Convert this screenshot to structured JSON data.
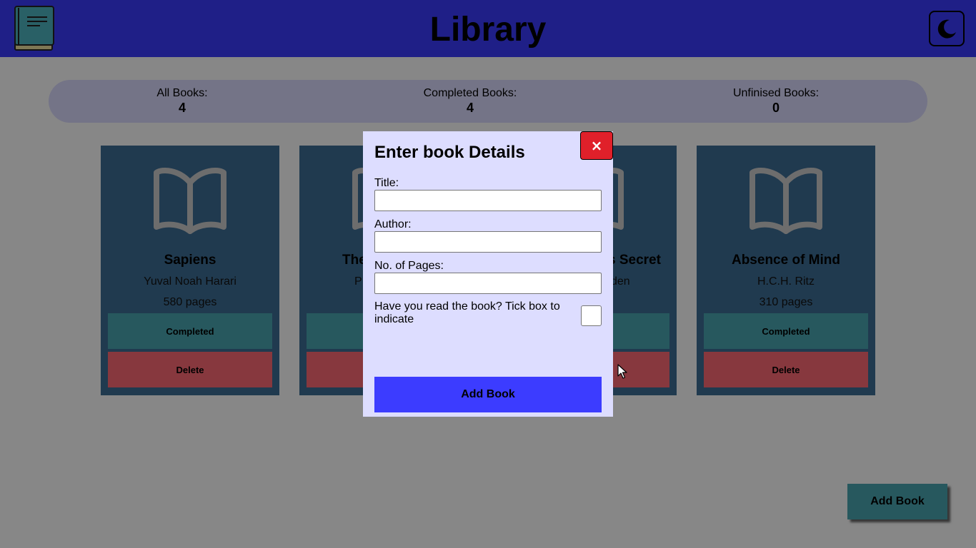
{
  "header": {
    "title": "Library",
    "logo_icon": "book-logo-icon",
    "theme_icon": "moon-icon"
  },
  "stats": [
    {
      "label": "All Books:",
      "value": "4"
    },
    {
      "label": "Completed Books:",
      "value": "4"
    },
    {
      "label": "Unfinised Books:",
      "value": "0"
    }
  ],
  "books": [
    {
      "title": "Sapiens",
      "author": "Yuval Noah Harari",
      "pages": "580 pages",
      "status_label": "Completed",
      "delete_label": "Delete"
    },
    {
      "title": "The",
      "author": "P",
      "pages": "",
      "status_label": "",
      "delete_label": ""
    },
    {
      "title": "s Secret",
      "author": "den",
      "pages": "",
      "status_label": "",
      "delete_label": ""
    },
    {
      "title": "Absence of Mind",
      "author": "H.C.H. Ritz",
      "pages": "310 pages",
      "status_label": "Completed",
      "delete_label": "Delete"
    }
  ],
  "fab": {
    "label": "Add Book"
  },
  "modal": {
    "title": "Enter book Details",
    "close_label": "×",
    "fields": [
      {
        "label": "Title:",
        "value": "",
        "placeholder": ""
      },
      {
        "label": "Author:",
        "value": "",
        "placeholder": ""
      },
      {
        "label": "No. of Pages:",
        "value": "",
        "placeholder": ""
      }
    ],
    "read_label": "Have you read the book? Tick box to indicate",
    "read_checked": false,
    "submit_label": "Add Book"
  },
  "colors": {
    "header": "#3c3cff",
    "card": "#3e6e96",
    "completed": "#4aa6b2",
    "delete": "#ff6b76",
    "modal": "#ddddff",
    "close": "#e0202a",
    "submit": "#3c3cff"
  }
}
